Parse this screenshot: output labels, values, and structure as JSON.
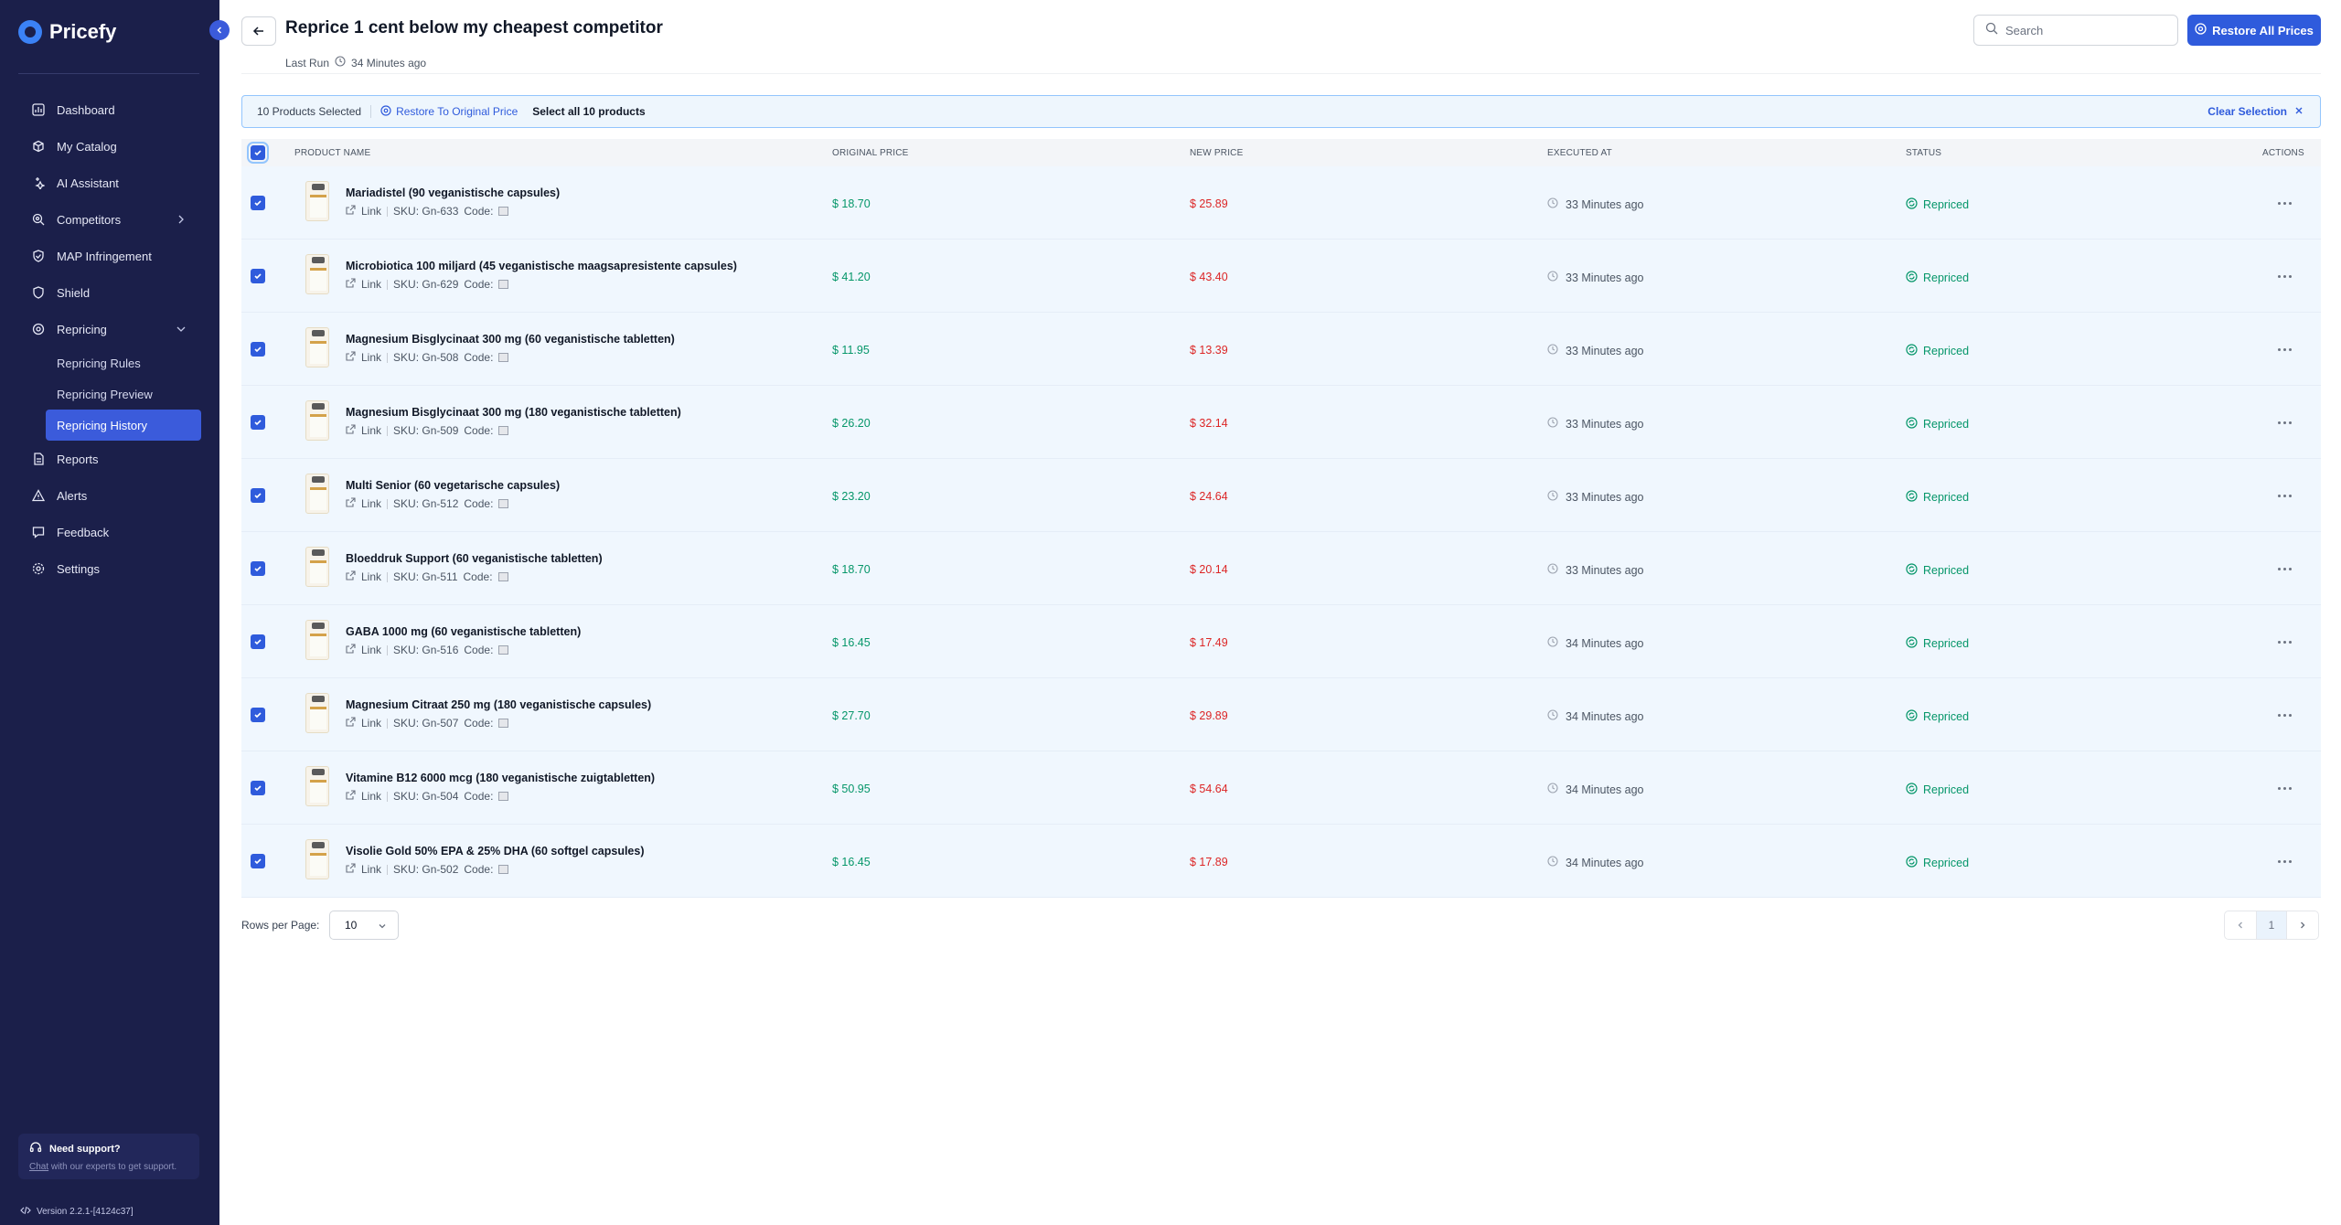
{
  "brand": {
    "name": "Pricefy"
  },
  "sidebar": {
    "items": [
      {
        "label": "Dashboard",
        "icon": "dashboard-icon"
      },
      {
        "label": "My Catalog",
        "icon": "catalog-icon"
      },
      {
        "label": "AI Assistant",
        "icon": "sparkle-icon"
      },
      {
        "label": "Competitors",
        "icon": "competitors-icon"
      },
      {
        "label": "MAP Infringement",
        "icon": "shield-check-icon"
      },
      {
        "label": "Shield",
        "icon": "shield-icon"
      },
      {
        "label": "Repricing",
        "icon": "repricing-icon"
      },
      {
        "label": "Reports",
        "icon": "reports-icon"
      },
      {
        "label": "Alerts",
        "icon": "alert-icon"
      },
      {
        "label": "Feedback",
        "icon": "feedback-icon"
      },
      {
        "label": "Settings",
        "icon": "settings-icon"
      }
    ],
    "repricing_sub": [
      "Repricing Rules",
      "Repricing Preview",
      "Repricing History"
    ],
    "active_sub": "Repricing History",
    "support": {
      "title": "Need support?",
      "link": "Chat",
      "text": " with our experts to get support."
    },
    "version": "Version 2.2.1-[4124c37]"
  },
  "header": {
    "title": "Reprice 1 cent below my cheapest competitor",
    "last_run_label": "Last Run",
    "last_run_value": "34 Minutes ago",
    "search_placeholder": "Search",
    "restore_all_label": "Restore All Prices"
  },
  "selection": {
    "count_label": "10 Products Selected",
    "restore_label": "Restore To Original Price",
    "select_all_label": "Select all 10 products",
    "clear_label": "Clear Selection"
  },
  "table": {
    "columns": [
      "Product Name",
      "Original Price",
      "New Price",
      "Executed At",
      "Status",
      "Actions"
    ],
    "link_label": "Link",
    "code_label": "Code:",
    "rows": [
      {
        "name": "Mariadistel (90 veganistische capsules)",
        "sku": "SKU: Gn-633",
        "original": "$ 18.70",
        "new": "$ 25.89",
        "executed": "33 Minutes ago",
        "status": "Repriced"
      },
      {
        "name": "Microbiotica 100 miljard (45 veganistische maagsapresistente capsules)",
        "sku": "SKU: Gn-629",
        "original": "$ 41.20",
        "new": "$ 43.40",
        "executed": "33 Minutes ago",
        "status": "Repriced"
      },
      {
        "name": "Magnesium Bisglycinaat 300 mg (60 veganistische tabletten)",
        "sku": "SKU: Gn-508",
        "original": "$ 11.95",
        "new": "$ 13.39",
        "executed": "33 Minutes ago",
        "status": "Repriced"
      },
      {
        "name": "Magnesium Bisglycinaat 300 mg (180 veganistische tabletten)",
        "sku": "SKU: Gn-509",
        "original": "$ 26.20",
        "new": "$ 32.14",
        "executed": "33 Minutes ago",
        "status": "Repriced"
      },
      {
        "name": "Multi Senior (60 vegetarische capsules)",
        "sku": "SKU: Gn-512",
        "original": "$ 23.20",
        "new": "$ 24.64",
        "executed": "33 Minutes ago",
        "status": "Repriced"
      },
      {
        "name": "Bloeddruk Support (60 veganistische tabletten)",
        "sku": "SKU: Gn-511",
        "original": "$ 18.70",
        "new": "$ 20.14",
        "executed": "33 Minutes ago",
        "status": "Repriced"
      },
      {
        "name": "GABA 1000 mg (60 veganistische tabletten)",
        "sku": "SKU: Gn-516",
        "original": "$ 16.45",
        "new": "$ 17.49",
        "executed": "34 Minutes ago",
        "status": "Repriced"
      },
      {
        "name": "Magnesium Citraat 250 mg (180 veganistische capsules)",
        "sku": "SKU: Gn-507",
        "original": "$ 27.70",
        "new": "$ 29.89",
        "executed": "34 Minutes ago",
        "status": "Repriced"
      },
      {
        "name": "Vitamine B12 6000 mcg (180 veganistische zuigtabletten)",
        "sku": "SKU: Gn-504",
        "original": "$ 50.95",
        "new": "$ 54.64",
        "executed": "34 Minutes ago",
        "status": "Repriced"
      },
      {
        "name": "Visolie Gold 50% EPA & 25% DHA (60 softgel capsules)",
        "sku": "SKU: Gn-502",
        "original": "$ 16.45",
        "new": "$ 17.89",
        "executed": "34 Minutes ago",
        "status": "Repriced"
      }
    ]
  },
  "footer": {
    "rows_per_page_label": "Rows per Page:",
    "rows_per_page_value": "10",
    "current_page": "1"
  },
  "colors": {
    "sidebar_bg": "#1b1f4a",
    "accent": "#2f5bdc",
    "green": "#059669",
    "red": "#dc2626"
  }
}
